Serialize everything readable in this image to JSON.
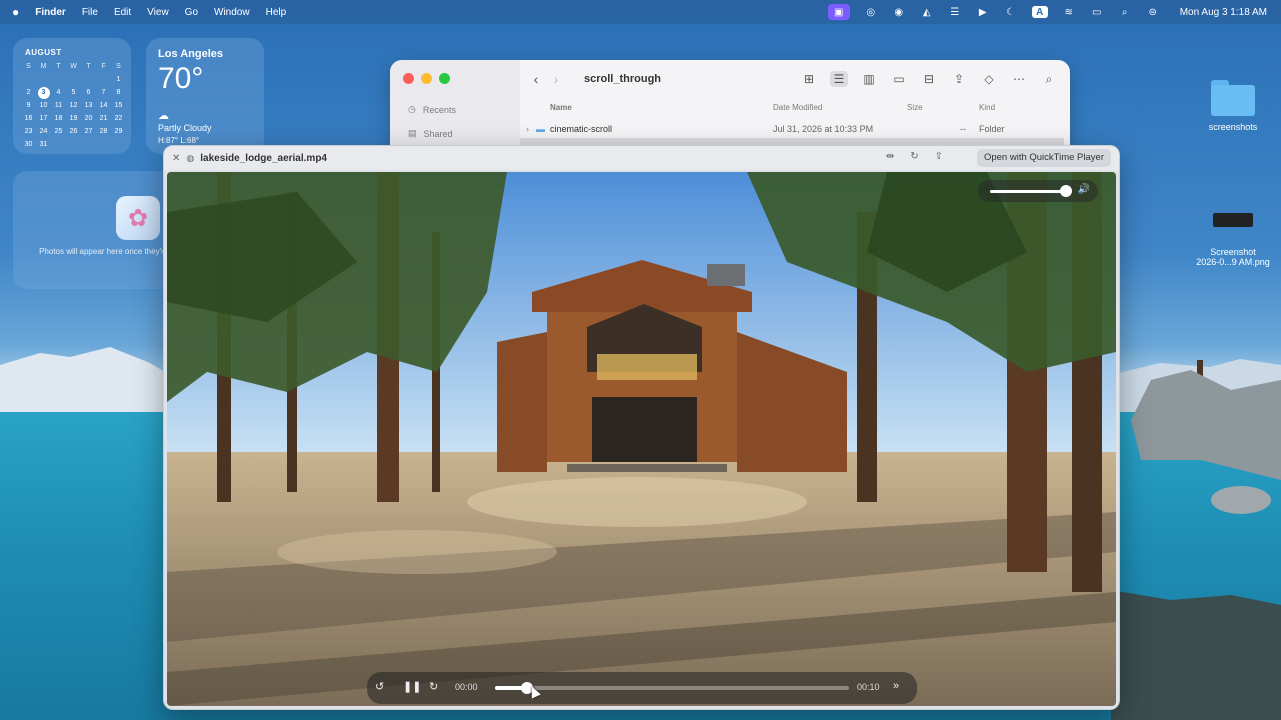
{
  "menubar": {
    "apple": "",
    "items": [
      "Finder",
      "File",
      "Edit",
      "View",
      "Go",
      "Window",
      "Help"
    ],
    "clock": "Mon Aug 3  1:18 AM",
    "status_icons": [
      "screen-record-icon",
      "focus-icon",
      "sync-icon",
      "app-icon",
      "messages-icon",
      "play-icon",
      "moon-icon",
      "keyboard-a-icon",
      "wifi-icon",
      "battery-icon",
      "search-icon",
      "control-center-icon"
    ],
    "ime_label": "A"
  },
  "calendar": {
    "month": "AUGUST",
    "weekdays": [
      "S",
      "M",
      "T",
      "W",
      "T",
      "F",
      "S"
    ],
    "today": 3,
    "days": [
      "",
      "",
      "",
      "",
      "",
      "",
      "1",
      "2",
      "3",
      "4",
      "5",
      "6",
      "7",
      "8",
      "9",
      "10",
      "11",
      "12",
      "13",
      "14",
      "15",
      "16",
      "17",
      "18",
      "19",
      "20",
      "21",
      "22",
      "23",
      "24",
      "25",
      "26",
      "27",
      "28",
      "29",
      "30",
      "31"
    ]
  },
  "weather": {
    "city": "Los Angeles",
    "temp": "70°",
    "condition": "Partly Cloudy",
    "high_low": "H:87° L:68°"
  },
  "photos_widget": {
    "message": "Photos will appear here once they're finished processing"
  },
  "desktop": {
    "folder_label": "screenshots",
    "screenshot_label_line1": "Screenshot",
    "screenshot_label_line2": "2026-0...9 AM.png"
  },
  "finder": {
    "title": "scroll_through",
    "sidebar": [
      "Recents",
      "Shared"
    ],
    "columns": {
      "name": "Name",
      "date": "Date Modified",
      "size": "Size",
      "kind": "Kind"
    },
    "rows": [
      {
        "name": "cinematic-scroll",
        "date": "Jul 31, 2026 at 10:33 PM",
        "size": "--",
        "kind": "Folder"
      }
    ]
  },
  "player": {
    "filename": "lakeside_lodge_aerial.mp4",
    "open_button": "Open with QuickTime Player",
    "time_current": "00:00",
    "time_total": "00:10",
    "progress": 0.09,
    "volume": 0.95
  },
  "colors": {
    "traffic_red": "#ff5f57",
    "traffic_yellow": "#febc2e",
    "traffic_green": "#28c840",
    "accent": "#7c5cff"
  }
}
